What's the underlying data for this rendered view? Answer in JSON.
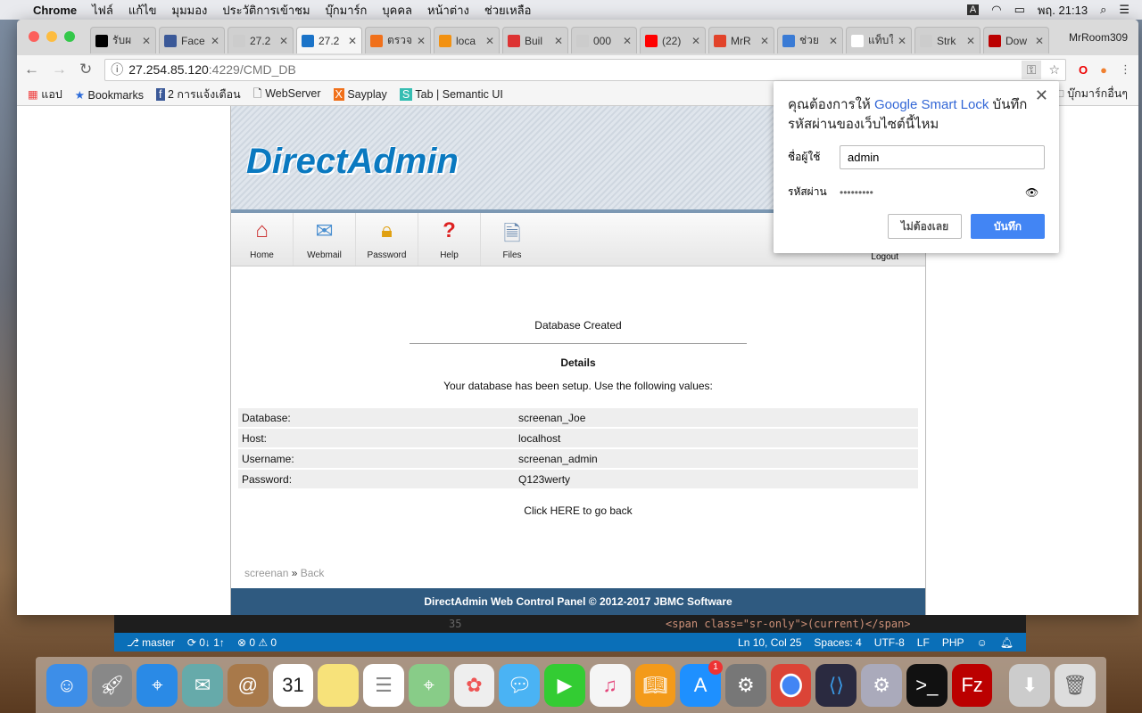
{
  "menubar": {
    "app": "Chrome",
    "items": [
      "ไฟล์",
      "แก้ไข",
      "มุมมอง",
      "ประวัติการเข้าชม",
      "บุ๊กมาร์ก",
      "บุคคล",
      "หน้าต่าง",
      "ช่วยเหลือ"
    ],
    "input_source": "A",
    "clock": "พฤ. 21:13"
  },
  "tabs": [
    {
      "label": "รับผ",
      "color": "#000"
    },
    {
      "label": "Face",
      "color": "#3b5998"
    },
    {
      "label": "27.2",
      "color": "#ccc"
    },
    {
      "label": "27.2",
      "color": "#1a73c8",
      "active": true
    },
    {
      "label": "ตรวจ",
      "color": "#f0701a"
    },
    {
      "label": "loca",
      "color": "#f29111"
    },
    {
      "label": "Buil",
      "color": "#d33"
    },
    {
      "label": "000",
      "color": "#ccc"
    },
    {
      "label": "(22)",
      "color": "#f00"
    },
    {
      "label": "MrR",
      "color": "#e2432a"
    },
    {
      "label": "ช่วย",
      "color": "#3a7bd5"
    },
    {
      "label": "แท็บใหม่",
      "color": "#fff"
    },
    {
      "label": "Strk",
      "color": "#ccc"
    },
    {
      "label": "Dow",
      "color": "#b00"
    }
  ],
  "profile": "MrRoom309",
  "url": {
    "host": "27.254.85.120",
    "rest": ":4229/CMD_DB"
  },
  "bookmarks": [
    "แอป",
    "Bookmarks",
    "2 การแจ้งเตือน",
    "WebServer",
    "Sayplay",
    "Tab | Semantic UI"
  ],
  "other_bookmarks": "บุ๊กมาร์กอื่นๆ",
  "da": {
    "logo": "DirectAdmin",
    "nav": [
      "Home",
      "Webmail",
      "Password",
      "Help",
      "Files"
    ],
    "logout": "Logout",
    "created": "Database Created",
    "details": "Details",
    "intro": "Your database has been setup. Use the following values:",
    "rows": [
      {
        "k": "Database:",
        "v": "screenan_Joe"
      },
      {
        "k": "Host:",
        "v": "localhost"
      },
      {
        "k": "Username:",
        "v": "screenan_admin"
      },
      {
        "k": "Password:",
        "v": "Q123werty"
      }
    ],
    "back": "Click HERE to go back",
    "crumb_user": "screenan",
    "crumb_sep": "»",
    "crumb_back": "Back",
    "footer": "DirectAdmin Web Control Panel © 2012-2017 JBMC Software"
  },
  "popup": {
    "title_pre": "คุณต้องการให้ ",
    "title_link": "Google Smart Lock",
    "title_post": " บันทึกรหัสผ่านของเว็บไซต์นี้ไหม",
    "user_label": "ชื่อผู้ใช้",
    "user_value": "admin",
    "pass_label": "รหัสผ่าน",
    "pass_value": "•••••••••",
    "cancel": "ไม่ต้องเลย",
    "save": "บันทึก"
  },
  "vscode": {
    "line": "35",
    "code": "<span class=\"sr-only\">(current)</span>",
    "branch": "master",
    "sync": "0↓ 1↑",
    "problems": "⊗ 0 ⚠ 0",
    "pos": "Ln 10, Col 25",
    "spaces": "Spaces: 4",
    "enc": "UTF-8",
    "eol": "LF",
    "lang": "PHP"
  },
  "dock": {
    "calendar_day": "31",
    "appstore_badge": "1"
  }
}
